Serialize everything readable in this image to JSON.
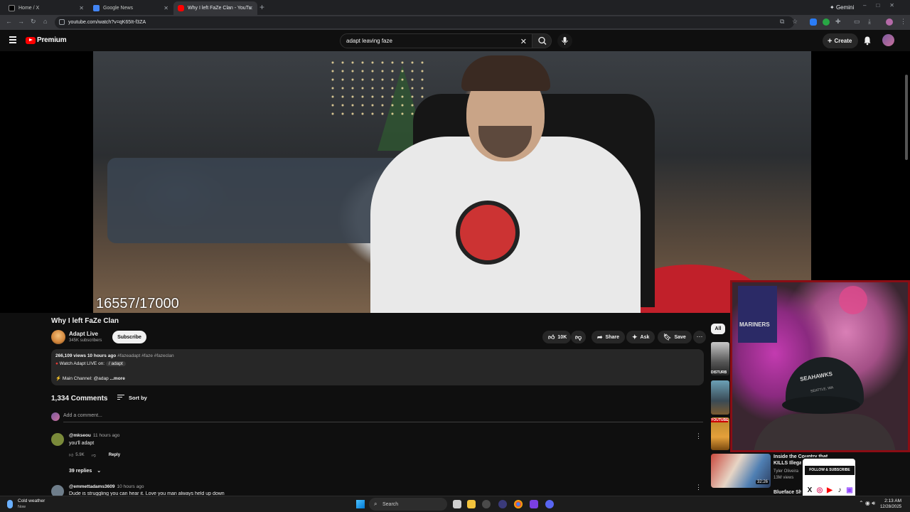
{
  "browser": {
    "tabs": [
      {
        "title": "Home / X",
        "favicon_color": "#000000"
      },
      {
        "title": "Google News",
        "favicon_color": "#4285f4"
      },
      {
        "title": "Why I left FaZe Clan - YouTu",
        "favicon_color": "#ff0000"
      }
    ],
    "gemini_label": "Gemini",
    "url": "youtube.com/watch?v=qK65It-f3ZA"
  },
  "header": {
    "logo_text": "Premium",
    "search_value": "adapt leaving faze",
    "create_label": "Create"
  },
  "video": {
    "overlay_counter": "16557/17000"
  },
  "watch": {
    "title": "Why I left FaZe Clan",
    "channel_name": "Adapt Live",
    "subscribers": "345K subscribers",
    "subscribe_label": "Subscribe",
    "like_count": "10K",
    "share_label": "Share",
    "ask_label": "Ask",
    "save_label": "Save"
  },
  "description": {
    "stats": "266,109 views  10 hours ago",
    "hashtags": "#fazeadapt #faze #fazeclan",
    "line2_prefix": "Watch Adapt LIVE on:",
    "line2_chip": "/ adapt",
    "line3_prefix": "Main Channel: @adap",
    "more_label": "...more"
  },
  "comments": {
    "count_label": "1,334 Comments",
    "sort_label": "Sort by",
    "add_placeholder": "Add a comment...",
    "items": [
      {
        "user": "@mkseou",
        "time": "11 hours ago",
        "text": "you'll adapt",
        "likes": "5.9K",
        "reply_label": "Reply",
        "replies_label": "39 replies"
      },
      {
        "user": "@emmettadams3609",
        "time": "10 hours ago",
        "text": "Dude is struggling you can hear it. Love you man always held up down"
      }
    ]
  },
  "sidebar": {
    "chip_all": "All",
    "thumb_label_1": "DISTURB",
    "thumb_label_3": "YOUTUBE",
    "rec1": {
      "title": "Inside the Country that KILLS Illegal Immig...",
      "channel": "Tyler Oliveira",
      "views": "13M views",
      "duration": "32:26"
    },
    "rec2": {
      "title": "Blueface Sh..."
    }
  },
  "webcam": {
    "poster_text": "MARINERS",
    "cap_text": "SEAHAWKS",
    "cap_sub": "SEATTLE, WA"
  },
  "social_overlay": {
    "banner": "FOLLOW & SUBSCRIBE @B_ROCKO"
  },
  "taskbar": {
    "weather_title": "Cold weather",
    "weather_sub": "Now",
    "search_placeholder": "Search",
    "time": "2:13 AM",
    "date": "12/28/2025"
  },
  "colors": {
    "youtube_red": "#ff0000",
    "webcam_border": "#8a0d14",
    "background": "#0f0f0f"
  }
}
